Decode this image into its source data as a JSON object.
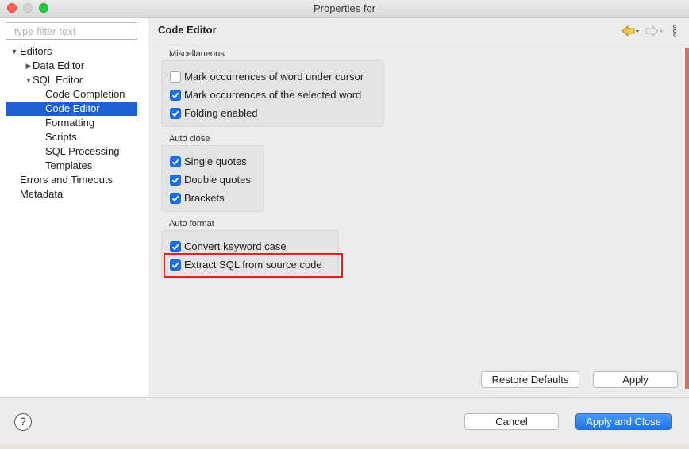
{
  "window": {
    "title": "Properties for"
  },
  "filter": {
    "placeholder": "type filter text",
    "value": ""
  },
  "tree": {
    "editors": "Editors",
    "data_editor": "Data Editor",
    "sql_editor": "SQL Editor",
    "code_completion": "Code Completion",
    "code_editor": "Code Editor",
    "formatting": "Formatting",
    "scripts": "Scripts",
    "sql_processing": "SQL Processing",
    "templates": "Templates",
    "errors_timeouts": "Errors and Timeouts",
    "metadata": "Metadata"
  },
  "page": {
    "title": "Code Editor"
  },
  "groups": {
    "misc": {
      "label": "Miscellaneous",
      "items": [
        {
          "label": "Mark occurrences of word under cursor",
          "checked": false
        },
        {
          "label": "Mark occurrences of the selected word",
          "checked": true
        },
        {
          "label": "Folding enabled",
          "checked": true
        }
      ]
    },
    "autoclose": {
      "label": "Auto close",
      "items": [
        {
          "label": "Single quotes",
          "checked": true
        },
        {
          "label": "Double quotes",
          "checked": true
        },
        {
          "label": "Brackets",
          "checked": true
        }
      ]
    },
    "autoformat": {
      "label": "Auto format",
      "items": [
        {
          "label": "Convert keyword case",
          "checked": true
        },
        {
          "label": "Extract SQL from source code",
          "checked": true
        }
      ]
    }
  },
  "buttons": {
    "restore_defaults": "Restore Defaults",
    "apply": "Apply",
    "cancel": "Cancel",
    "apply_close": "Apply and Close",
    "help": "?"
  },
  "colors": {
    "selection": "#1e5fd6",
    "checkbox_on": "#1a6ee6",
    "highlight": "#e0241b",
    "primary": "#1a73ee"
  },
  "icons": [
    "back-arrow-icon",
    "forward-arrow-icon",
    "dropdown-icon",
    "view-menu-icon",
    "help-icon"
  ]
}
